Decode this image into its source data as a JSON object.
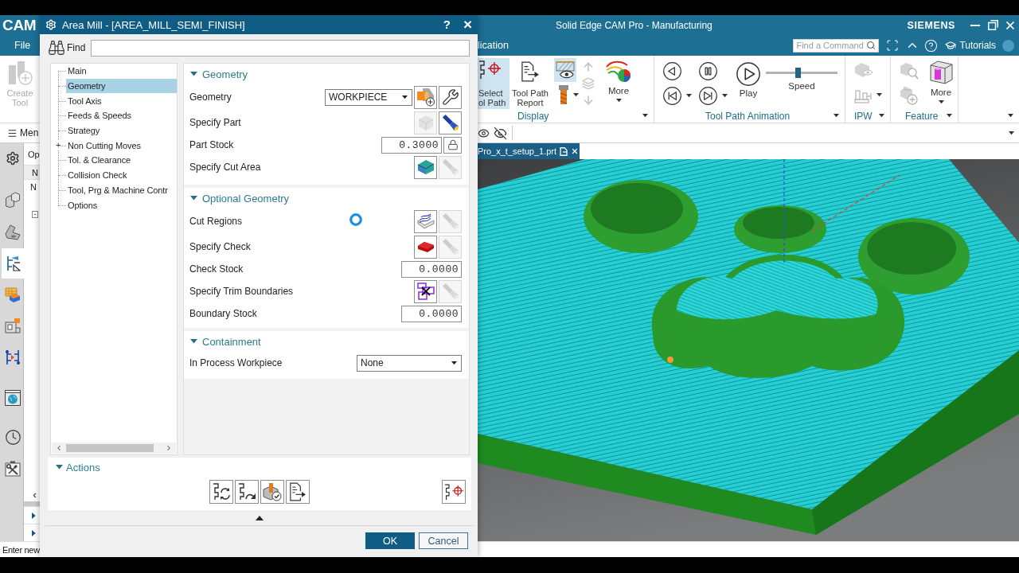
{
  "app": {
    "logo": "CAM",
    "title": "Solid Edge CAM Pro - Manufacturing",
    "brand": "SIEMENS"
  },
  "menu_tabs": [
    "File",
    "lication"
  ],
  "command_search": {
    "placeholder": "Find a Command"
  },
  "tutorials": "Tutorials",
  "ribbon": {
    "create_tool": {
      "label": "Create\nTool",
      "disabled": true
    },
    "display": {
      "label": "Display",
      "select_tool_path": {
        "label": "Select\nol Path",
        "selected": true
      },
      "report": {
        "label": "Tool Path\nReport"
      },
      "path_display": {
        "selected": true
      },
      "reorder": {
        "disabled": true
      },
      "more": {
        "label": "More"
      }
    },
    "animation": {
      "label": "Tool Path Animation",
      "play": {
        "label": "Play"
      },
      "speed": {
        "label": "Speed",
        "level": 0.44
      }
    },
    "ipw": {
      "label": "IPW",
      "disabled": true
    },
    "feature": {
      "label": "Feature",
      "disabled": true,
      "more": {
        "label": "More"
      }
    }
  },
  "menu_label": "Men",
  "nav_rail": [
    {
      "selected": false
    },
    {
      "selected": false
    },
    {
      "selected": false
    },
    {
      "selected": true
    },
    {
      "selected": false
    },
    {
      "selected": false
    },
    {
      "selected": false
    },
    {
      "selected": false
    },
    {
      "selected": false
    },
    {
      "selected": false
    }
  ],
  "navigator": {
    "title": "Op",
    "header": "N",
    "rows": [
      "N"
    ],
    "expander": "-"
  },
  "document_tab": {
    "label": "Pro_x_t_setup_1.prt",
    "selected": true
  },
  "status_text": "Enter new",
  "dialog": {
    "title": "Area Mill - [AREA_MILL_SEMI_FINISH]",
    "controls": [
      "?",
      "×"
    ],
    "find_label": "Find",
    "tree": [
      {
        "label": "Main",
        "selected": false
      },
      {
        "label": "Geometry",
        "selected": true
      },
      {
        "label": "Tool Axis",
        "selected": false
      },
      {
        "label": "Feeds & Speeds",
        "selected": false
      },
      {
        "label": "Strategy",
        "selected": false
      },
      {
        "label": "Non Cutting Moves",
        "selected": false,
        "expander": "+"
      },
      {
        "label": "Tol. & Clearance",
        "selected": false
      },
      {
        "label": "Collision Check",
        "selected": false
      },
      {
        "label": "Tool, Prg & Machine Contr",
        "selected": false
      },
      {
        "label": "Options",
        "selected": false
      }
    ],
    "sections": [
      {
        "title": "Geometry",
        "expanded": true,
        "rows": [
          {
            "kind": "dropdown",
            "label": "Geometry",
            "value": "WORKPIECE",
            "buttons": [
              {
                "kind": "new",
                "disabled": false
              },
              {
                "kind": "edit",
                "disabled": false
              }
            ]
          },
          {
            "kind": "select",
            "label": "Specify Part",
            "buttons": [
              {
                "kind": "part",
                "disabled": true
              },
              {
                "kind": "display",
                "disabled": false
              }
            ]
          },
          {
            "kind": "number",
            "label": "Part Stock",
            "value": "0.3000",
            "buttons": [
              {
                "kind": "lock",
                "disabled": false
              }
            ]
          },
          {
            "kind": "select",
            "label": "Specify Cut Area",
            "buttons": [
              {
                "kind": "area",
                "disabled": false
              },
              {
                "kind": "display",
                "disabled": true
              }
            ]
          }
        ]
      },
      {
        "title": "Optional Geometry",
        "expanded": true,
        "rows": [
          {
            "kind": "select",
            "label": "Cut Regions",
            "buttons": [
              {
                "kind": "regions",
                "disabled": false
              },
              {
                "kind": "display",
                "disabled": true
              }
            ]
          },
          {
            "kind": "select",
            "label": "Specify Check",
            "buttons": [
              {
                "kind": "check",
                "disabled": false
              },
              {
                "kind": "display",
                "disabled": true
              }
            ]
          },
          {
            "kind": "number",
            "label": "Check Stock",
            "value": "0.0000"
          },
          {
            "kind": "select",
            "label": "Specify Trim Boundaries",
            "buttons": [
              {
                "kind": "trim",
                "disabled": false
              },
              {
                "kind": "display",
                "disabled": true
              }
            ]
          },
          {
            "kind": "number",
            "label": "Boundary Stock",
            "value": "0.0000"
          }
        ]
      },
      {
        "title": "Containment",
        "expanded": true,
        "rows": [
          {
            "kind": "dropdown",
            "label": "In Process Workpiece",
            "value": "None"
          }
        ]
      }
    ],
    "actions": {
      "title": "Actions",
      "expanded": true
    },
    "buttons": [
      {
        "label": "OK",
        "default": true
      },
      {
        "label": "Cancel",
        "default": false
      }
    ]
  }
}
